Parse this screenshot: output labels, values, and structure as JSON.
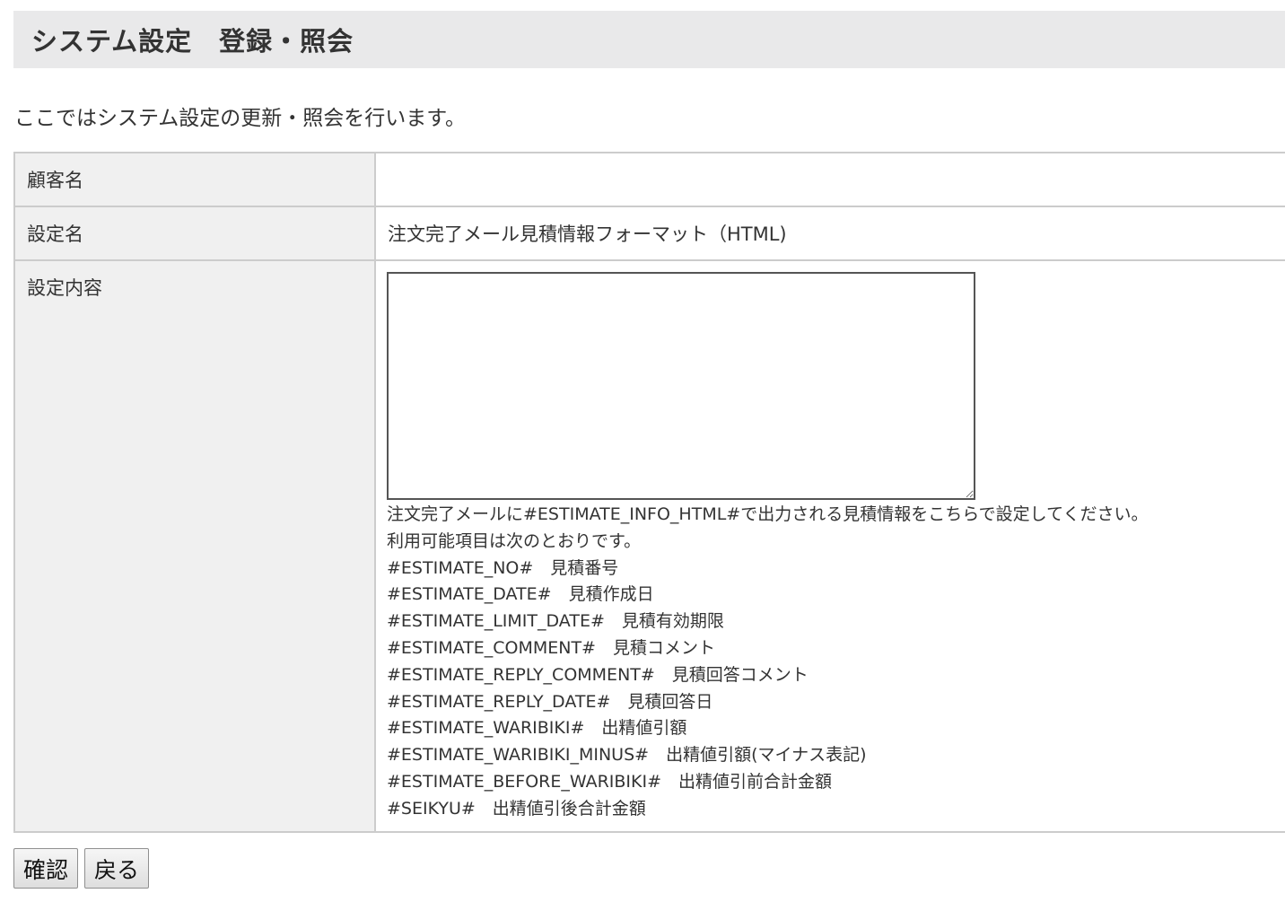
{
  "header": {
    "title": "システム設定　登録・照会"
  },
  "description": "ここではシステム設定の更新・照会を行います。",
  "form": {
    "customer_label": "顧客名",
    "customer_value": "",
    "setting_name_label": "設定名",
    "setting_name_value": "注文完了メール見積情報フォーマット（HTML)",
    "setting_content_label": "設定内容",
    "setting_content_value": "",
    "help_lines": [
      "注文完了メールに#ESTIMATE_INFO_HTML#で出力される見積情報をこちらで設定してください。",
      "利用可能項目は次のとおりです。",
      "#ESTIMATE_NO#　見積番号",
      "#ESTIMATE_DATE#　見積作成日",
      "#ESTIMATE_LIMIT_DATE#　見積有効期限",
      "#ESTIMATE_COMMENT#　見積コメント",
      "#ESTIMATE_REPLY_COMMENT#　見積回答コメント",
      "#ESTIMATE_REPLY_DATE#　見積回答日",
      "#ESTIMATE_WARIBIKI#　出精値引額",
      "#ESTIMATE_WARIBIKI_MINUS#　出精値引額(マイナス表記)",
      "#ESTIMATE_BEFORE_WARIBIKI#　出精値引前合計金額",
      "#SEIKYU#　出精値引後合計金額"
    ]
  },
  "buttons": {
    "confirm_label": "確認",
    "back_label": "戻る"
  }
}
